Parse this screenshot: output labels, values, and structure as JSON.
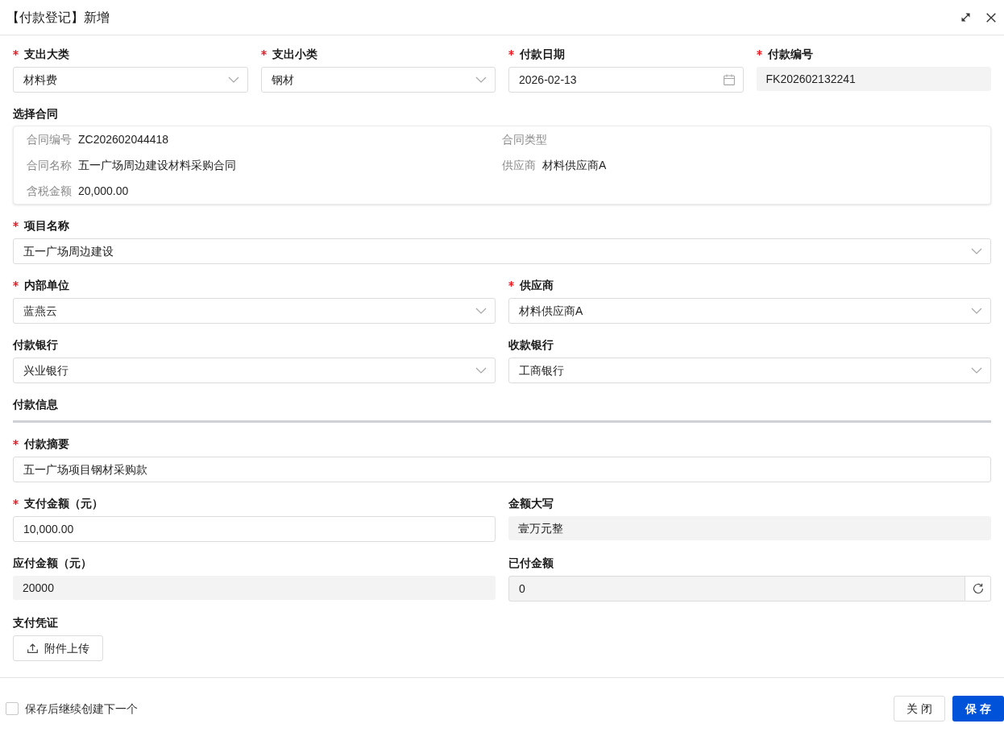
{
  "dialog": {
    "title": "【付款登记】新增"
  },
  "rows": [
    {
      "kind": "fields",
      "fields": [
        {
          "kind": "select",
          "label": "支出大类",
          "required": true,
          "value": "材料费"
        },
        {
          "kind": "select",
          "label": "支出小类",
          "required": true,
          "value": "钢材"
        },
        {
          "kind": "date",
          "label": "付款日期",
          "required": true,
          "value": "2026-02-13"
        },
        {
          "kind": "readonly",
          "label": "付款编号",
          "required": true,
          "value": "FK202602132241"
        }
      ]
    },
    {
      "kind": "contract",
      "label": "选择合同",
      "details": [
        {
          "label": "合同编号",
          "value": "ZC202602044418"
        },
        {
          "label": "合同类型"
        },
        {
          "label": "合同名称",
          "value": "五一广场周边建设材料采购合同"
        },
        {
          "label": "供应商",
          "value": "材料供应商A"
        },
        {
          "label": "含税金额",
          "value": "20,000.00"
        }
      ]
    },
    {
      "kind": "fields",
      "fields": [
        {
          "kind": "select",
          "label": "项目名称",
          "required": true,
          "value": "五一广场周边建设"
        }
      ]
    },
    {
      "kind": "fields",
      "fields": [
        {
          "kind": "select",
          "label": "内部单位",
          "required": true,
          "value": "蓝燕云"
        },
        {
          "kind": "select",
          "label": "供应商",
          "required": true,
          "value": "材料供应商A"
        }
      ]
    },
    {
      "kind": "fields",
      "fields": [
        {
          "kind": "select",
          "label": "付款银行",
          "required": false,
          "value": "兴业银行"
        },
        {
          "kind": "select",
          "label": "收款银行",
          "required": false,
          "value": "工商银行"
        }
      ]
    },
    {
      "kind": "section",
      "title": "付款信息"
    },
    {
      "kind": "fields",
      "fields": [
        {
          "kind": "input",
          "label": "付款摘要",
          "required": true,
          "value": "五一广场项目钢材采购款"
        }
      ]
    },
    {
      "kind": "fields",
      "fields": [
        {
          "kind": "input",
          "label": "支付金额（元）",
          "required": true,
          "value": "10,000.00"
        },
        {
          "kind": "readonly",
          "label": "金额大写",
          "required": false,
          "value": "壹万元整"
        }
      ]
    },
    {
      "kind": "fields",
      "fields": [
        {
          "kind": "readonly",
          "label": "应付金额（元）",
          "required": false,
          "value": "20000"
        },
        {
          "kind": "refresh",
          "label": "已付金额",
          "required": false,
          "value": "0"
        }
      ]
    },
    {
      "kind": "fields",
      "fields": [
        {
          "kind": "upload",
          "label": "支付凭证",
          "required": false,
          "button": "附件上传"
        }
      ]
    }
  ],
  "footer": {
    "checkbox": {
      "label": "保存后继续创建下一个",
      "checked": false
    },
    "buttons": [
      {
        "kind": "default",
        "label": "关 闭"
      },
      {
        "kind": "primary",
        "label": "保 存"
      }
    ]
  }
}
